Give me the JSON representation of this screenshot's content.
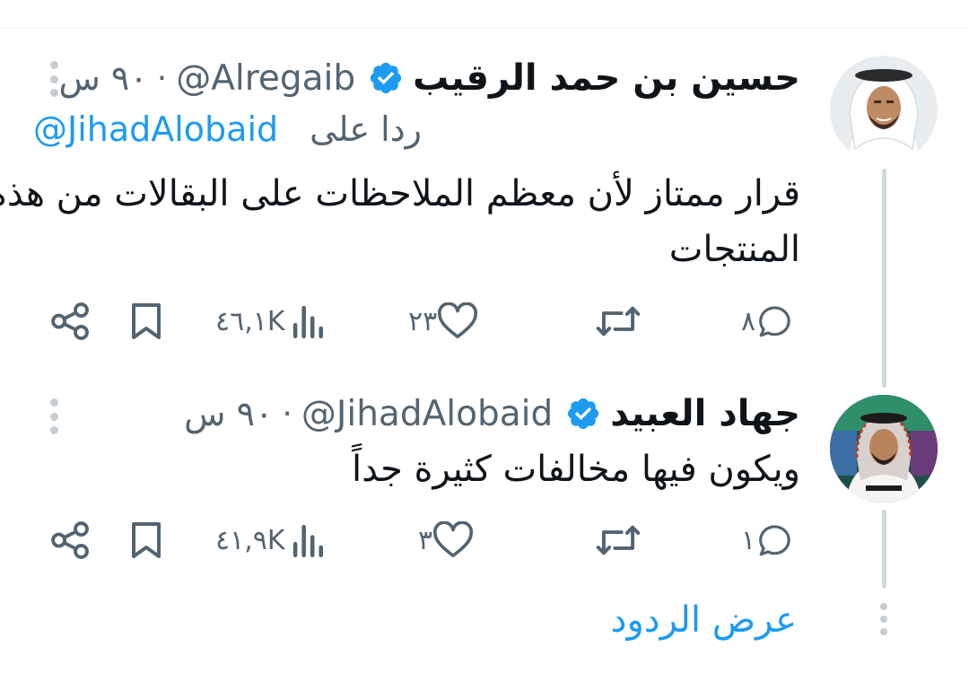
{
  "colors": {
    "accent": "#1d9bf0",
    "muted": "#536471",
    "text": "#0f1419",
    "thread_line": "#cfd9de"
  },
  "tweets": [
    {
      "name": "حسين بن حمد الرقيب",
      "handle": "@Alregaib",
      "separator": "·",
      "time": "٩٠ س",
      "reply_prefix": "ردا على",
      "reply_handle": "@JihadAlobaid",
      "body_line1": "قرار ممتاز لأن معظم الملاحظات على البقالات من هذه",
      "body_line2": "المنتجات",
      "replies": "٨",
      "retweets": "",
      "likes": "٢٣",
      "views": "٤٦,١K",
      "avatar_icon": "avatar-man-white-shemagh"
    },
    {
      "name": "جهاد العبيد",
      "handle": "@JihadAlobaid",
      "separator": "·",
      "time": "٩٠ س",
      "body_line1": "ويكون فيها مخالفات كثيرة جداً",
      "replies": "١",
      "retweets": "",
      "likes": "٣",
      "views": "٤١,٩K",
      "avatar_icon": "avatar-man-red-shemagh"
    }
  ],
  "show_replies": "عرض الردود"
}
